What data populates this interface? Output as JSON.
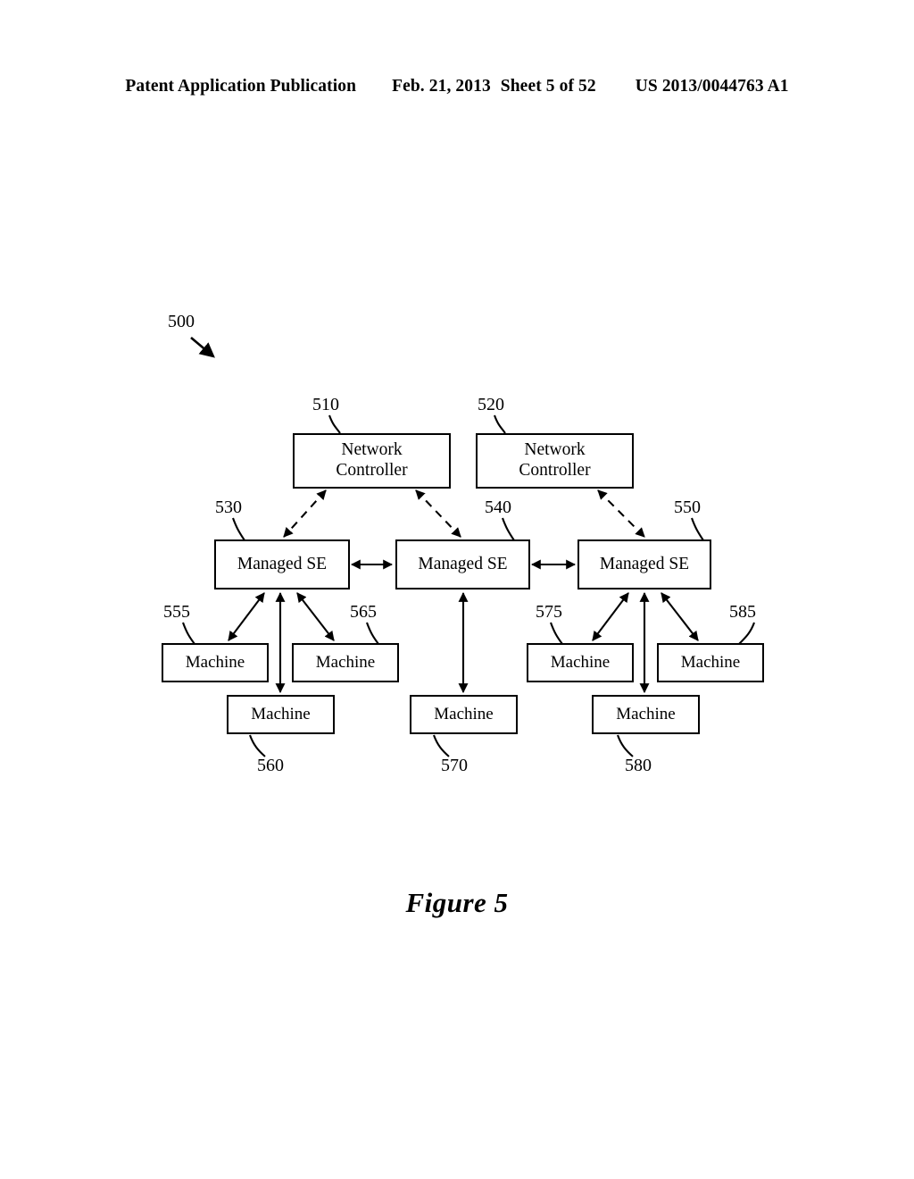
{
  "header": {
    "publication": "Patent Application Publication",
    "date": "Feb. 21, 2013",
    "sheet": "Sheet 5 of 52",
    "patent_number": "US 2013/0044763 A1"
  },
  "figure": {
    "caption": "Figure 5",
    "system_ref": "500"
  },
  "diagram": {
    "controllers": [
      {
        "ref": "510",
        "label": "Network Controller",
        "line1": "Network",
        "line2": "Controller"
      },
      {
        "ref": "520",
        "label": "Network Controller",
        "line1": "Network",
        "line2": "Controller"
      }
    ],
    "switching_elements": [
      {
        "ref": "530",
        "label": "Managed SE"
      },
      {
        "ref": "540",
        "label": "Managed SE"
      },
      {
        "ref": "550",
        "label": "Managed SE"
      }
    ],
    "machines": [
      {
        "ref": "555",
        "label": "Machine"
      },
      {
        "ref": "560",
        "label": "Machine"
      },
      {
        "ref": "565",
        "label": "Machine"
      },
      {
        "ref": "570",
        "label": "Machine"
      },
      {
        "ref": "575",
        "label": "Machine"
      },
      {
        "ref": "580",
        "label": "Machine"
      },
      {
        "ref": "585",
        "label": "Machine"
      }
    ]
  }
}
